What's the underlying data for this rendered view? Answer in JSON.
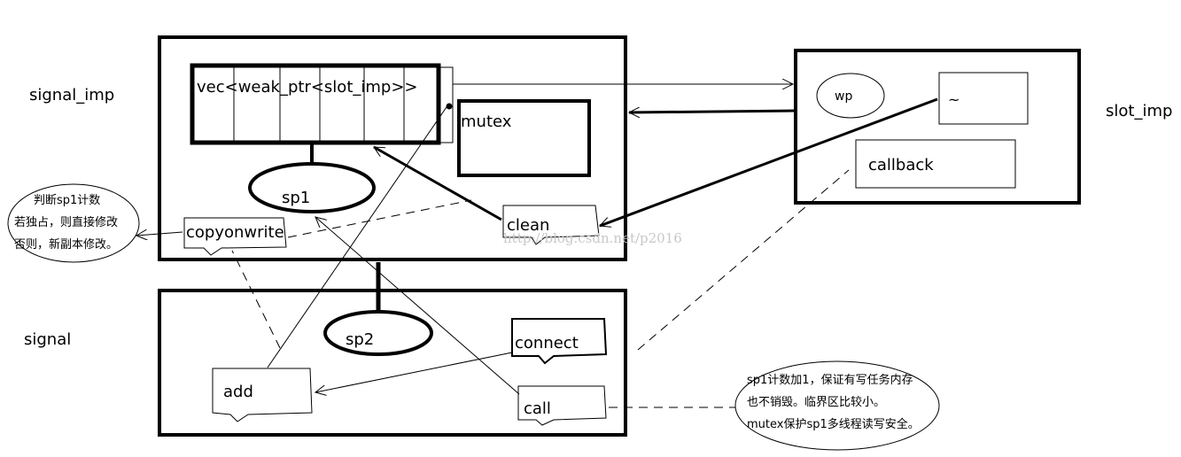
{
  "labels": {
    "signal_imp": "signal_imp",
    "signal": "signal",
    "slot_imp": "slot_imp"
  },
  "signal_imp_box": {
    "vec": "vec<weak_ptr<slot_imp>>",
    "mutex": "mutex",
    "sp1": "sp1",
    "copyonwrite": "copyonwrite",
    "clean": "clean"
  },
  "signal_box": {
    "sp2": "sp2",
    "connect": "connect",
    "add": "add",
    "call": "call"
  },
  "slot_imp_box": {
    "wp": "wp",
    "destructor": "~",
    "callback": "callback"
  },
  "notes": {
    "copyonwrite_note": [
      "判断sp1计数",
      "若独占，则直接修改",
      "否则，新副本修改。"
    ],
    "call_note": [
      "sp1计数加1，保证有写任务内存",
      "也不销毁。临界区比较小。",
      "mutex保护sp1多线程读写安全。"
    ]
  },
  "watermark": "http://blog.csdn.net/p2016"
}
